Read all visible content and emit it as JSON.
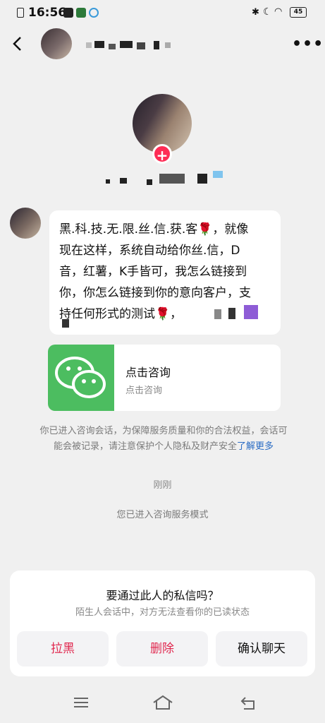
{
  "status_bar": {
    "time": "16:56",
    "battery": "45"
  },
  "header": {
    "back_icon": "chevron-left-icon",
    "more_icon": "more-dots-icon",
    "more_text": "•••"
  },
  "profile": {
    "plus_text": "+"
  },
  "message": {
    "lines": [
      "黑.科.技.无.限.丝.信.获.客🌹，就像",
      "现在这样，系统自动给你丝.信，D",
      "音，红薯，K手皆可，我怎么链接到",
      "你，你怎么链接到你的意向客户，支",
      "持任何形式的测试🌹，"
    ]
  },
  "card": {
    "title": "点击咨询",
    "subtitle": "点击咨询",
    "icon": "wechat-icon"
  },
  "notice": {
    "text": "你已进入咨询会话，为保障服务质量和你的合法权益，会话可能会被记录，请注意保护个人隐私及财产安全",
    "link": "了解更多"
  },
  "timestamp": "刚刚",
  "mode_text": "您已进入咨询服务模式",
  "sheet": {
    "question": "要通过此人的私信吗？",
    "hint": "陌生人会话中，对方无法查看你的已读状态",
    "buttons": [
      "拉黑",
      "删除",
      "确认聊天"
    ],
    "colors": {
      "danger": "#e0284f",
      "normal": "#111111"
    }
  },
  "colors": {
    "accent": "#fe2c55",
    "wechat": "#4cbd60",
    "link": "#2a6cc4"
  }
}
